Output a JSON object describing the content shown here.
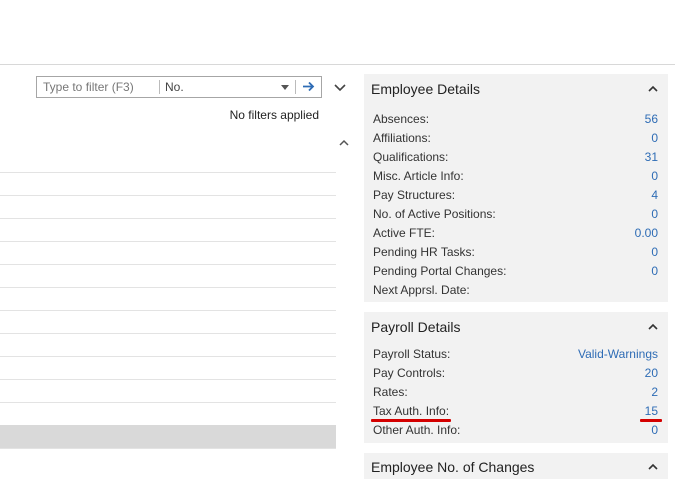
{
  "filter": {
    "placeholder": "Type to filter (F3)",
    "field": "No.",
    "status": "No filters applied"
  },
  "list": {
    "row_count": 13,
    "selected_index": 11
  },
  "factboxes": {
    "employee_details": {
      "title": "Employee Details",
      "rows": [
        {
          "label": "Absences:",
          "value": "56"
        },
        {
          "label": "Affiliations:",
          "value": "0"
        },
        {
          "label": "Qualifications:",
          "value": "31"
        },
        {
          "label": "Misc. Article Info:",
          "value": "0"
        },
        {
          "label": "Pay Structures:",
          "value": "4"
        },
        {
          "label": "No. of Active Positions:",
          "value": "0"
        },
        {
          "label": "Active FTE:",
          "value": "0.00"
        },
        {
          "label": "Pending HR Tasks:",
          "value": "0"
        },
        {
          "label": "Pending Portal Changes:",
          "value": "0"
        },
        {
          "label": "Next Apprsl. Date:",
          "value": ""
        }
      ]
    },
    "payroll_details": {
      "title": "Payroll Details",
      "rows": [
        {
          "label": "Payroll Status:",
          "value": "Valid-Warnings"
        },
        {
          "label": "Pay Controls:",
          "value": "20"
        },
        {
          "label": "Rates:",
          "value": "2"
        },
        {
          "label": "Tax Auth. Info:",
          "value": "15"
        },
        {
          "label": "Other Auth. Info:",
          "value": "0"
        }
      ]
    },
    "employee_changes": {
      "title": "Employee No. of Changes"
    }
  },
  "colors": {
    "link": "#2e6cb5",
    "highlight": "#d40000",
    "factbox_bg": "#f2f2f2",
    "selected_row": "#d9d9d9"
  }
}
